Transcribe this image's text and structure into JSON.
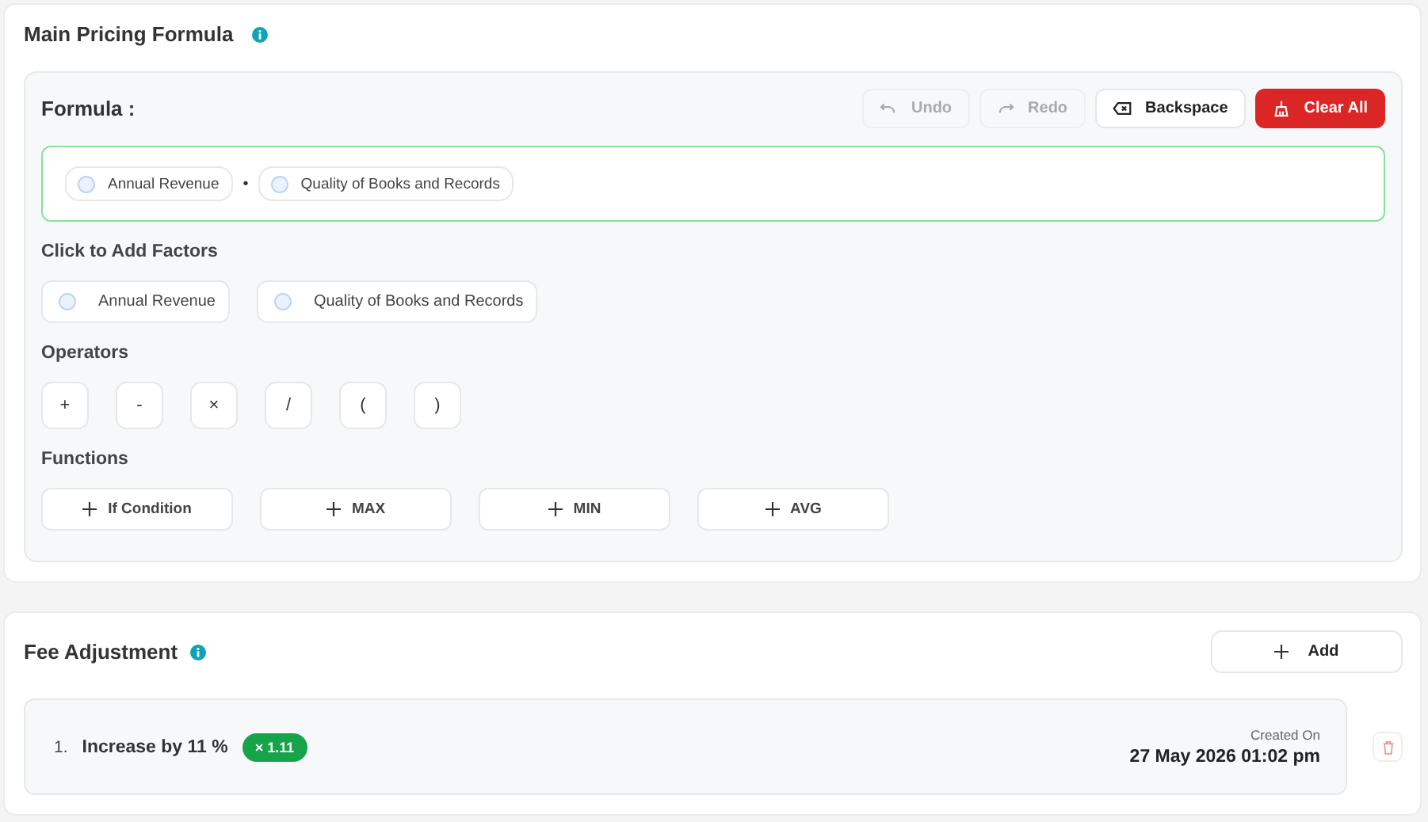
{
  "pricing": {
    "title": "Main Pricing Formula",
    "formula": {
      "label": "Formula :",
      "actions": [
        {
          "kind": "undo",
          "label": "Undo",
          "disabled": true
        },
        {
          "kind": "redo",
          "label": "Redo",
          "disabled": true
        },
        {
          "kind": "backspace",
          "label": "Backspace",
          "disabled": false
        },
        {
          "kind": "clear",
          "label": "Clear All",
          "disabled": false
        }
      ],
      "tokens": [
        {
          "kind": "factor",
          "label": "Annual Revenue"
        },
        {
          "kind": "operator",
          "label": "•"
        },
        {
          "kind": "factor",
          "label": "Quality of Books and Records"
        }
      ]
    },
    "factors_label": "Click to Add Factors",
    "factors": [
      "Annual Revenue",
      "Quality of Books and Records"
    ],
    "operators_label": "Operators",
    "operators": [
      "+",
      "-",
      "×",
      "/",
      "(",
      ")"
    ],
    "functions_label": "Functions",
    "functions": [
      "If Condition",
      "MAX",
      "MIN",
      "AVG"
    ]
  },
  "fee": {
    "title": "Fee Adjustment",
    "add_label": "Add",
    "items": [
      {
        "number": "1.",
        "label": "Increase by 11 %",
        "badge": "× 1.11",
        "created_label": "Created On",
        "created": "27 May 2026 01:02 pm"
      }
    ]
  }
}
